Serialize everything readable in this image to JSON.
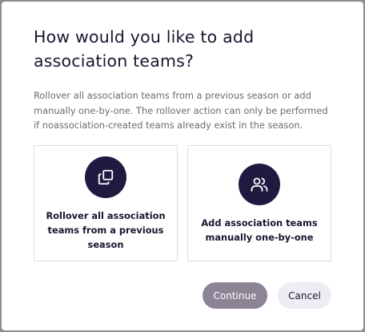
{
  "dialog": {
    "title": "How would you like to add association teams?",
    "description": "Rollover all association teams from a previous season or add manually one-by-one. The rollover action can only be performed if noassociation-created teams already exist in the season.",
    "options": [
      {
        "label": "Rollover all association teams from a previous season",
        "icon": "copy-icon"
      },
      {
        "label": "Add association teams manually one-by-one",
        "icon": "users-icon"
      }
    ],
    "buttons": {
      "continue": "Continue",
      "cancel": "Cancel"
    }
  },
  "colors": {
    "icon_circle": "#21193f",
    "continue_bg": "#8c8494",
    "cancel_bg": "#eceef3",
    "title_text": "#1b1530"
  }
}
